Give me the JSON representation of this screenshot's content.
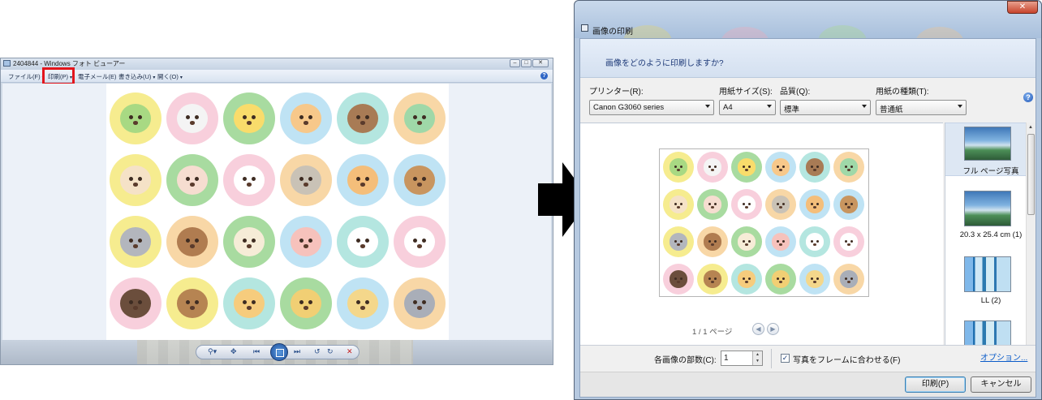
{
  "viewer": {
    "title": "2404844 - Windows フォト ビューアー",
    "menu": [
      {
        "label": "ファイル(F)",
        "has_caret": true
      },
      {
        "label": "印刷(P)",
        "has_caret": true
      },
      {
        "label": "電子メール(E)",
        "has_caret": false
      },
      {
        "label": "書き込み(U)",
        "has_caret": true
      },
      {
        "label": "開く(O)",
        "has_caret": true
      }
    ],
    "help_icon": "?",
    "window_buttons": [
      "minimize-icon",
      "maximize-icon",
      "close-icon"
    ],
    "controls": [
      {
        "icon": "zoom-icon",
        "glyph": "⚲▾"
      },
      {
        "icon": "actual-size-icon",
        "glyph": "✥"
      },
      {
        "icon": "previous-icon",
        "glyph": "⏮"
      },
      {
        "icon": "slideshow-icon",
        "glyph": ""
      },
      {
        "icon": "next-icon",
        "glyph": "⏭"
      },
      {
        "icon": "rotate-left-icon",
        "glyph": "↺"
      },
      {
        "icon": "rotate-right-icon",
        "glyph": "↻"
      },
      {
        "icon": "delete-icon",
        "glyph": "✕"
      }
    ],
    "animals": [
      {
        "name": "frog",
        "bg": "#f6ec8f",
        "face": "#a8d983"
      },
      {
        "name": "seal",
        "bg": "#f8cfdc",
        "face": "#f4f4f4"
      },
      {
        "name": "chick",
        "bg": "#a8dba0",
        "face": "#f9dc6b"
      },
      {
        "name": "tiger-cat",
        "bg": "#bfe3f4",
        "face": "#f7c88a"
      },
      {
        "name": "bear-brown",
        "bg": "#b4e6e0",
        "face": "#a87b55"
      },
      {
        "name": "snake",
        "bg": "#f8d7a6",
        "face": "#9fd8a8"
      },
      {
        "name": "hedgehog",
        "bg": "#f6ec8f",
        "face": "#f5e2c7"
      },
      {
        "name": "rabbit",
        "bg": "#a8dba0",
        "face": "#f6ddd0"
      },
      {
        "name": "chicken",
        "bg": "#f8cfdc",
        "face": "#ffffff"
      },
      {
        "name": "cat",
        "bg": "#f8d7a6",
        "face": "#c9c2b6"
      },
      {
        "name": "shiba",
        "bg": "#bfe3f4",
        "face": "#f4be7a"
      },
      {
        "name": "monkey",
        "bg": "#bfe3f4",
        "face": "#c8955f"
      },
      {
        "name": "koala",
        "bg": "#f6ec8f",
        "face": "#b3b6bd"
      },
      {
        "name": "tanuki",
        "bg": "#f8d7a6",
        "face": "#b07c50"
      },
      {
        "name": "sheep",
        "bg": "#a8dba0",
        "face": "#f6ecd7"
      },
      {
        "name": "pig",
        "bg": "#bfe3f4",
        "face": "#f6c2bc"
      },
      {
        "name": "cow",
        "bg": "#b4e6e0",
        "face": "#ffffff"
      },
      {
        "name": "panda",
        "bg": "#f8cfdc",
        "face": "#ffffff"
      },
      {
        "name": "black-bear",
        "bg": "#f8cfdc",
        "face": "#6b4e3c"
      },
      {
        "name": "bear",
        "bg": "#f6ec8f",
        "face": "#b68452"
      },
      {
        "name": "tiger",
        "bg": "#b4e6e0",
        "face": "#f6cc7d"
      },
      {
        "name": "lion",
        "bg": "#a8dba0",
        "face": "#f1cf74"
      },
      {
        "name": "giraffe",
        "bg": "#bfe3f4",
        "face": "#f4d78b"
      },
      {
        "name": "elephant",
        "bg": "#f8d7a6",
        "face": "#a9aeb8"
      }
    ]
  },
  "dialog": {
    "title": "画像の印刷",
    "close_glyph": "✕",
    "question": "画像をどのように印刷しますか?",
    "printer": {
      "label": "プリンター(R):",
      "value": "Canon G3060 series"
    },
    "paper_size": {
      "label": "用紙サイズ(S):",
      "value": "A4"
    },
    "quality": {
      "label": "品質(Q):",
      "value": "標準"
    },
    "paper_type": {
      "label": "用紙の種類(T):",
      "value": "普通紙"
    },
    "help_icon": "?",
    "pager": "1 / 1 ページ",
    "layouts": [
      {
        "label": "フル ページ写真",
        "selected": true
      },
      {
        "label": "20.3 x 25.4 cm (1)",
        "selected": false
      },
      {
        "label": "LL (2)",
        "selected": false
      },
      {
        "label": "",
        "selected": false
      }
    ],
    "copies": {
      "label": "各画像の部数(C):",
      "value": "1"
    },
    "fit_frame": {
      "label": "写真をフレームに合わせる(F)",
      "checked": true
    },
    "options_link": "オプション...",
    "print_button": "印刷(P)",
    "cancel_button": "キャンセル"
  }
}
